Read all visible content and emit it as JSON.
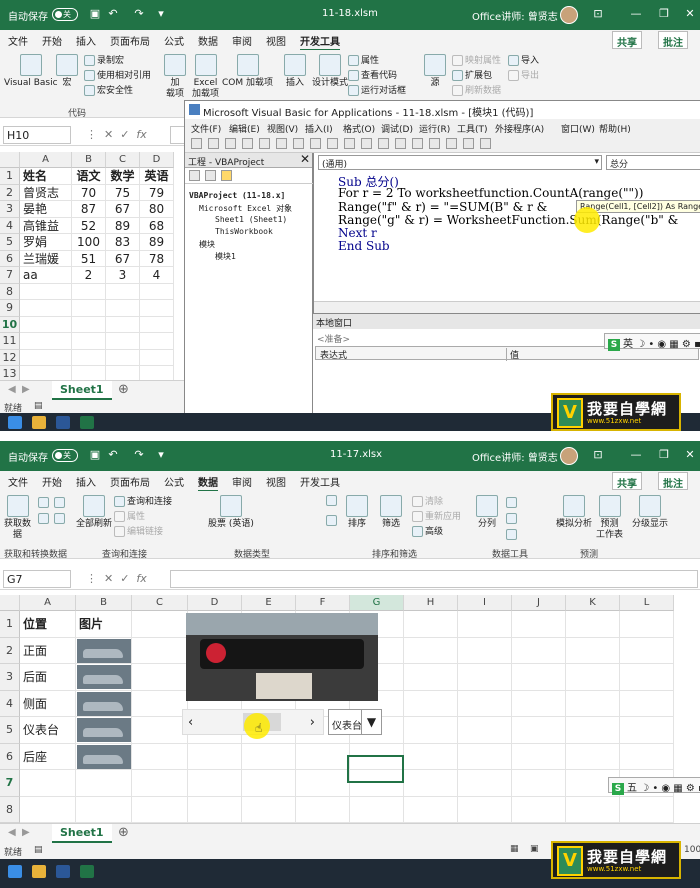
{
  "top": {
    "title": {
      "autosave": "自动保存",
      "autosave_state": "关",
      "filename": "11-18.xlsm",
      "user": "Office讲师: 曾贤志"
    },
    "tabs": [
      "文件",
      "开始",
      "插入",
      "页面布局",
      "公式",
      "数据",
      "审阅",
      "视图",
      "开发工具"
    ],
    "active_tab": "开发工具",
    "share": "共享",
    "comment": "批注",
    "ribbon": {
      "visual_basic": "Visual Basic",
      "macro": "宏",
      "record_macro": "录制宏",
      "relative_ref": "使用相对引用",
      "macro_security": "宏安全性",
      "code_group": "代码",
      "addin": "加",
      "addin2": "载项",
      "excel_addin": "Excel",
      "excel_addin2": "加载项",
      "com_addin": "COM 加载项",
      "insert": "插入",
      "design_mode": "设计模式",
      "properties": "属性",
      "view_code": "查看代码",
      "run_dialog": "运行对话框",
      "source": "源",
      "map_props": "映射属性",
      "expansion": "扩展包",
      "refresh": "刷新数据",
      "import": "导入",
      "export": "导出"
    },
    "namebox": "H10",
    "columns": [
      "A",
      "B",
      "C",
      "D"
    ],
    "rows": [
      "1",
      "2",
      "3",
      "4",
      "5",
      "6",
      "7",
      "8",
      "9",
      "10",
      "11",
      "12",
      "13"
    ],
    "table": [
      [
        "姓名",
        "语文",
        "数学",
        "英语"
      ],
      [
        "曾贤志",
        "70",
        "75",
        "79"
      ],
      [
        "晏艳",
        "87",
        "67",
        "80"
      ],
      [
        "高锥益",
        "52",
        "89",
        "68"
      ],
      [
        "罗娟",
        "100",
        "83",
        "89"
      ],
      [
        "兰瑞媛",
        "51",
        "67",
        "78"
      ],
      [
        "aa",
        "2",
        "3",
        "4"
      ]
    ],
    "sheet": "Sheet1",
    "status": "就绪",
    "vbe": {
      "title": "Microsoft Visual Basic for Applications - 11-18.xlsm - [模块1 (代码)]",
      "menu": [
        "文件(F)",
        "编辑(E)",
        "视图(V)",
        "插入(I)",
        "格式(O)",
        "调试(D)",
        "运行(R)",
        "工具(T)",
        "外接程序(A)",
        "窗口(W)",
        "帮助(H)"
      ],
      "project_title": "工程 - VBAProject",
      "tree": [
        "VBAProject (11-18.x]",
        "Microsoft Excel 对象",
        "Sheet1 (Sheet1)",
        "ThisWorkbook",
        "模块",
        "模块1"
      ],
      "combo_left": "(通用)",
      "combo_right": "总分",
      "code": [
        "Sub 总分()",
        "For r = 2 To worksheetfunction.CountA(range(\"\"))",
        "    Range(\"f\" & r) = \"=SUM(B\" & r &",
        "    Range(\"g\" & r) = WorksheetFunction.Sum(Range(\"b\" &",
        "Next r",
        "End Sub"
      ],
      "tooltip": "Range(Cell1, [Cell2]) As Range",
      "immediate_title": "本地窗口",
      "ready": "<准备>",
      "col_expr": "表达式",
      "col_value": "值"
    }
  },
  "bottom": {
    "title": {
      "autosave": "自动保存",
      "autosave_state": "关",
      "filename": "11-17.xlsx",
      "user": "Office讲师: 曾贤志"
    },
    "tabs": [
      "文件",
      "开始",
      "插入",
      "页面布局",
      "公式",
      "数据",
      "审阅",
      "视图",
      "开发工具"
    ],
    "active_tab": "数据",
    "share": "共享",
    "comment": "批注",
    "ribbon": {
      "get_data": "获取数",
      "get_data2": "据",
      "refresh_all": "全部刷新",
      "queries": "查询和连接",
      "props": "属性",
      "edit_links": "编辑链接",
      "stocks": "股票 (英语)",
      "sort": "排序",
      "filter": "筛选",
      "clear": "清除",
      "reapply": "重新应用",
      "advanced": "高级",
      "split": "分列",
      "whatif": "模拟分析",
      "forecast": "预测",
      "forecast2": "工作表",
      "outline": "分级显示",
      "g1": "获取和转换数据",
      "g2": "查询和连接",
      "g3": "数据类型",
      "g4": "排序和筛选",
      "g5": "数据工具",
      "g6": "预测"
    },
    "namebox": "G7",
    "columns": [
      "A",
      "B",
      "C",
      "D",
      "E",
      "F",
      "G",
      "H",
      "I",
      "J",
      "K",
      "L"
    ],
    "rows": [
      "1",
      "2",
      "3",
      "4",
      "5",
      "6",
      "7",
      "8"
    ],
    "header": [
      "位置",
      "图片"
    ],
    "positions": [
      "正面",
      "后面",
      "侧面",
      "仪表台",
      "后座"
    ],
    "dropdown_value": "仪表台",
    "scroll_left": "‹",
    "scroll_right": "›",
    "sheet": "Sheet1",
    "status": "就绪",
    "zoom": "100"
  },
  "ime": {
    "lang": "英",
    "lang2": "五"
  },
  "logo": {
    "text": "我要自學網",
    "url": "www.51zxw.net"
  },
  "colors": {
    "excel_green": "#217346",
    "highlight": "#ffeb00"
  }
}
